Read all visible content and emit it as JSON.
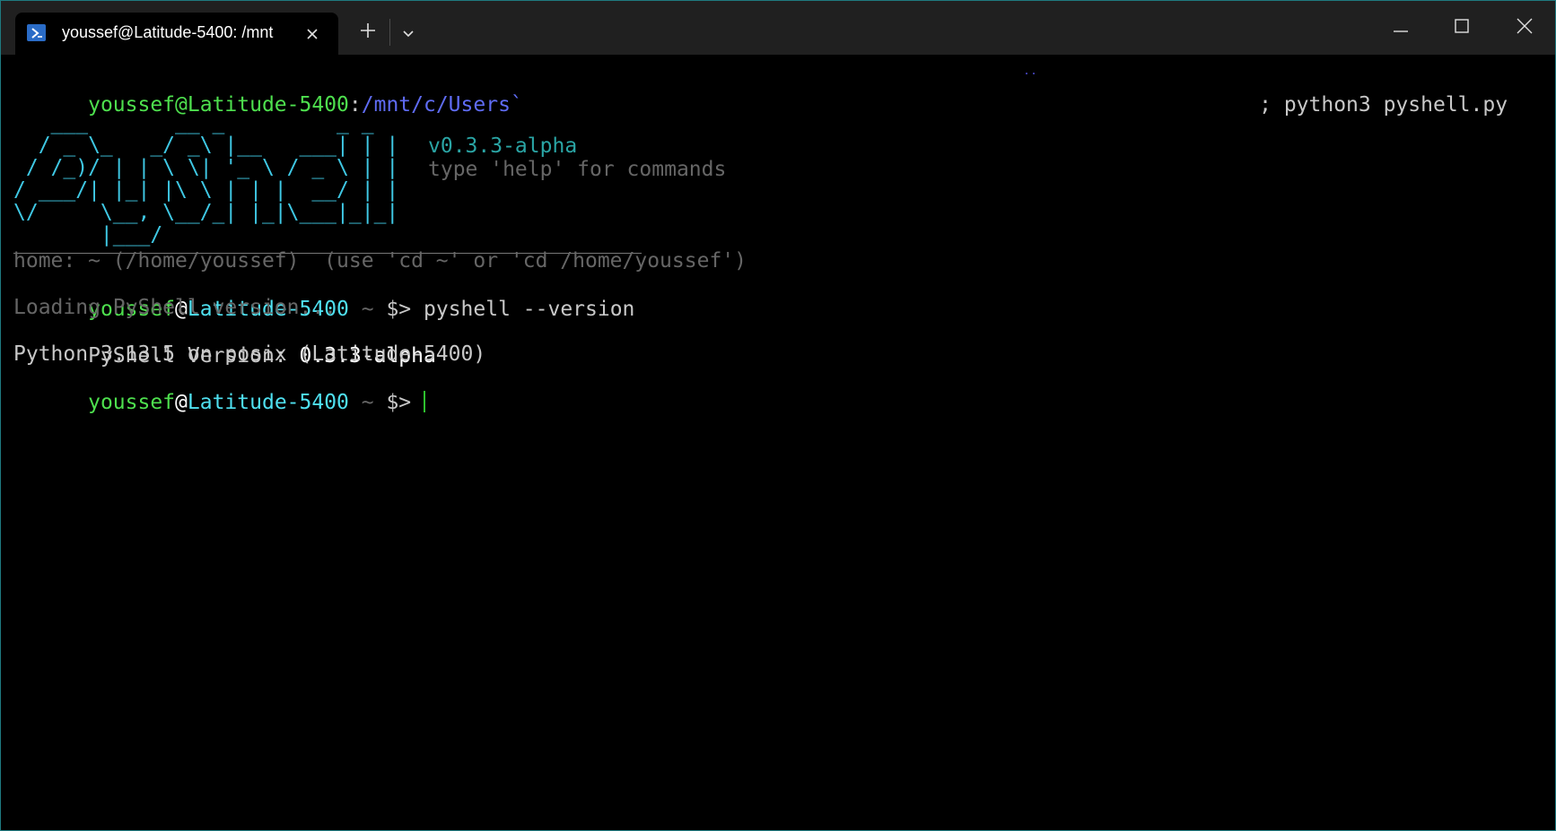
{
  "window": {
    "tab_title": "youssef@Latitude-5400: /mnt",
    "tab_icon": "powershell-icon",
    "new_tab_icon": "plus-icon",
    "dropdown_icon": "chevron-down-icon",
    "minimize_icon": "minimize-icon",
    "maximize_icon": "maximize-icon",
    "close_icon": "close-icon"
  },
  "terminal": {
    "cmdline": {
      "user": "youssef@Latitude-5400",
      "colon": ":",
      "path": "/mnt/c/Users",
      "path_tail": "`",
      "command_prefix": ";",
      "command": "python3 pyshell.py"
    },
    "logo": "   ___       __ _         _ _\n  / _ \\_   _/ _\\ |__   ___| | |\n / /_)/ | | \\ \\| '_ \\ / _ \\ | |\n/ ___/| |_| |\\ \\ | | |  __/ | |\n\\/     \\__, \\__/_| |_|\\___|_|_|\n       |___/",
    "version": "v0.3.3-alpha",
    "help_hint": "type 'help' for commands",
    "home_line": "home: ~ (/home/youssef)  (use 'cd ~' or 'cd /home/youssef')",
    "prompt1": {
      "user": "youssef",
      "at": "@",
      "host": "Latitude-5400",
      "cwd": " ~ ",
      "sigil": "$>",
      "command": " pyshell --version"
    },
    "loading": "Loading PyShell version...",
    "version_label": "PyShell Version: ",
    "version_value": "0.3.3-alpha",
    "python_info": "Python 3.13.5 on posix (Latitude-5400)",
    "prompt2": {
      "user": "youssef",
      "at": "@",
      "host": "Latitude-5400",
      "cwd": " ~ ",
      "sigil": "$> "
    }
  },
  "colors": {
    "green": "#4ee04e",
    "cyan": "#4fe0f0",
    "path_blue": "#5f6cf4",
    "logo": "#3fc8e4",
    "version_teal": "#2aa5a5",
    "muted": "#666666",
    "window_border": "#1f7a80"
  }
}
